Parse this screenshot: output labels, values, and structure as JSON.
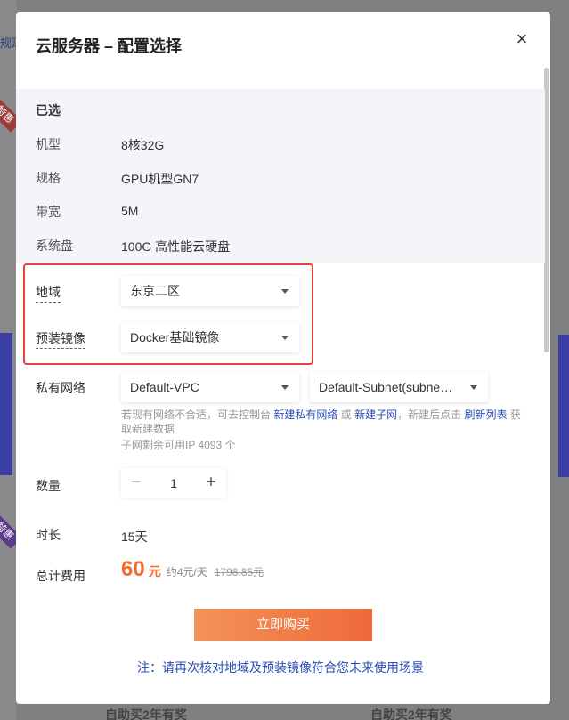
{
  "background": {
    "link_fragment": "规则",
    "ribbon_label": "特惠",
    "bottom_text_1": "自助买2年有奖",
    "bottom_text_2": "自助买2年有奖"
  },
  "modal": {
    "title": "云服务器 – 配置选择",
    "close_glyph": "×"
  },
  "selected": {
    "heading": "已选",
    "rows": [
      {
        "label": "机型",
        "value": "8核32G"
      },
      {
        "label": "规格",
        "value": "GPU机型GN7"
      },
      {
        "label": "带宽",
        "value": "5M"
      },
      {
        "label": "系统盘",
        "value": "100G 高性能云硬盘"
      }
    ]
  },
  "region": {
    "label": "地域",
    "value": "东京二区"
  },
  "image": {
    "label": "预装镜像",
    "value": "Docker基础镜像"
  },
  "network": {
    "label": "私有网络",
    "vpc": "Default-VPC",
    "subnet": "Default-Subnet(subne…",
    "hint_prefix": "若现有网络不合适，可去控制台",
    "link_new_vpc": "新建私有网络",
    "or": "或",
    "link_new_subnet": "新建子网",
    "hint_middle": "，新建后点击",
    "link_refresh": "刷新列表",
    "hint_suffix": "获取新建数据",
    "ip_remaining": "子网剩余可用IP 4093 个"
  },
  "quantity": {
    "label": "数量",
    "minus": "−",
    "value": "1",
    "plus": "+"
  },
  "duration": {
    "label": "时长",
    "value": "15天"
  },
  "cost": {
    "label": "总计费用",
    "amount": "60",
    "unit": "元",
    "daily": "约4元/天",
    "original": "1798.85元"
  },
  "buy_button": "立即购买",
  "notice": "注：请再次核对地域及预装镜像符合您未来使用场景",
  "colors": {
    "accent_orange": "#f56b2b",
    "link_blue": "#2a4db8",
    "highlight_red": "#e5443c"
  }
}
